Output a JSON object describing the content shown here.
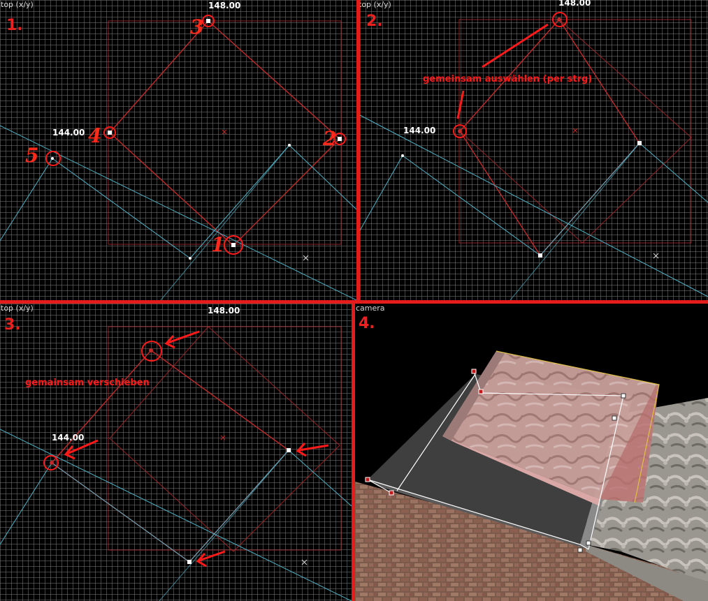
{
  "views": {
    "v1": {
      "label": "top (x/y)",
      "panel_number": "1.",
      "coord_top": "148.00",
      "coord_left": "144.00",
      "handwritten": {
        "n1": "1",
        "n2": "2",
        "n3": "3",
        "n4": "4",
        "n5": "5"
      }
    },
    "v2": {
      "label": "top (x/y)",
      "panel_number": "2.",
      "coord_top": "148.00",
      "coord_left": "144.00",
      "annotation": "gemeinsam auswählen (per strg)"
    },
    "v3": {
      "label": "top (x/y)",
      "panel_number": "3.",
      "coord_top": "148.00",
      "coord_left": "144.00",
      "annotation": "gemainsam verschieben"
    },
    "v4": {
      "label": "camera",
      "panel_number": "4."
    }
  },
  "colors": {
    "separator": "#e41c1c",
    "annotation_red": "#ff1a1a",
    "brush_edge": "#b4282a",
    "cyan_edge": "#4fb3c8",
    "grid": "#787878"
  }
}
